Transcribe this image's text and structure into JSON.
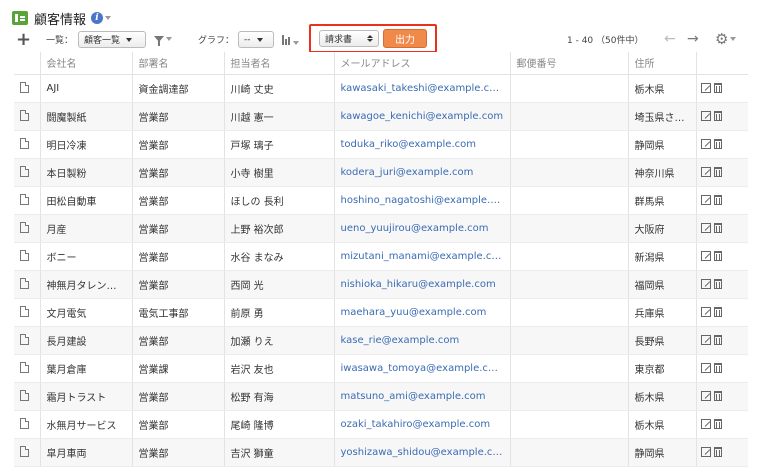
{
  "header": {
    "title": "顧客情報",
    "app_icon": "app-icon",
    "info_icon": "info-icon"
  },
  "toolbar": {
    "add_icon": "plus-icon",
    "list_label": "一覧：",
    "list_value": "顧客一覧",
    "filter_icon": "funnel-icon",
    "graph_label": "グラフ：",
    "graph_value": "--",
    "chart_icon": "bar-chart-icon",
    "report_value": "請求書",
    "output_label": "出力",
    "highlight_color": "#e8321e",
    "output_color": "#f08a4b",
    "pager_text": "1 - 40 （50件中）",
    "prev_icon": "←",
    "next_icon": "→",
    "gear_icon": "⚙"
  },
  "table": {
    "columns": [
      "",
      "会社名",
      "部署名",
      "担当者名",
      "メールアドレス",
      "郵便番号",
      "住所",
      ""
    ],
    "rows": [
      {
        "company": "AJI",
        "dept": "資金調達部",
        "person": "川崎 丈史",
        "email": "kawasaki_takeshi@example.com",
        "zip": "",
        "addr": "栃木県"
      },
      {
        "company": "闘魔製紙",
        "dept": "営業部",
        "person": "川越 憲一",
        "email": "kawagoe_kenichi@example.com",
        "zip": "",
        "addr": "埼玉県さいたま市"
      },
      {
        "company": "明日冷凍",
        "dept": "営業部",
        "person": "戸塚 璃子",
        "email": "toduka_riko@example.com",
        "zip": "",
        "addr": "静岡県"
      },
      {
        "company": "本日製粉",
        "dept": "営業部",
        "person": "小寺 樹里",
        "email": "kodera_juri@example.com",
        "zip": "",
        "addr": "神奈川県"
      },
      {
        "company": "田松自動車",
        "dept": "営業部",
        "person": "ほしの 長利",
        "email": "hoshino_nagatoshi@example.com",
        "zip": "",
        "addr": "群馬県"
      },
      {
        "company": "月産",
        "dept": "営業部",
        "person": "上野 裕次郎",
        "email": "ueno_yuujirou@example.com",
        "zip": "",
        "addr": "大阪府"
      },
      {
        "company": "ボニー",
        "dept": "営業部",
        "person": "水谷 まなみ",
        "email": "mizutani_manami@example.com",
        "zip": "",
        "addr": "新潟県"
      },
      {
        "company": "神無月タレントプロダクション",
        "dept": "営業部",
        "person": "西岡 光",
        "email": "nishioka_hikaru@example.com",
        "zip": "",
        "addr": "福岡県"
      },
      {
        "company": "文月電気",
        "dept": "電気工事部",
        "person": "前原 勇",
        "email": "maehara_yuu@example.com",
        "zip": "",
        "addr": "兵庫県"
      },
      {
        "company": "長月建設",
        "dept": "営業部",
        "person": "加瀬 りえ",
        "email": "kase_rie@example.com",
        "zip": "",
        "addr": "長野県"
      },
      {
        "company": "葉月倉庫",
        "dept": "営業課",
        "person": "岩沢 友也",
        "email": "iwasawa_tomoya@example.com",
        "zip": "",
        "addr": "東京都"
      },
      {
        "company": "霜月トラスト",
        "dept": "営業部",
        "person": "松野 有海",
        "email": "matsuno_ami@example.com",
        "zip": "",
        "addr": "栃木県"
      },
      {
        "company": "水無月サービス",
        "dept": "営業部",
        "person": "尾崎 隆博",
        "email": "ozaki_takahiro@example.com",
        "zip": "",
        "addr": "栃木県"
      },
      {
        "company": "皐月車両",
        "dept": "営業部",
        "person": "吉沢 獅童",
        "email": "yoshizawa_shidou@example.com",
        "zip": "",
        "addr": "静岡県"
      }
    ]
  }
}
